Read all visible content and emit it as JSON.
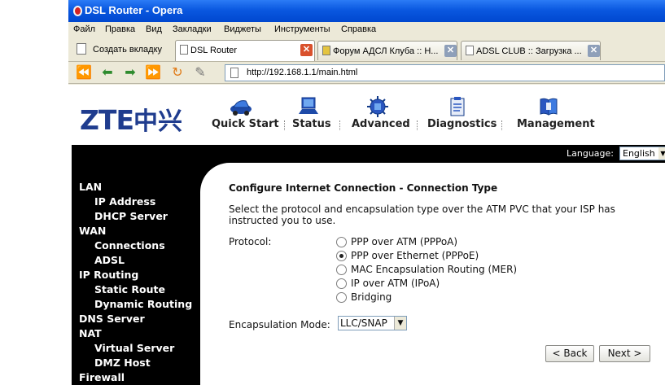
{
  "window": {
    "title": "DSL Router - Opera"
  },
  "menu": [
    "Файл",
    "Правка",
    "Вид",
    "Закладки",
    "Виджеты",
    "Инструменты",
    "Справка"
  ],
  "tabs": {
    "new_tab_label": "Создать вкладку",
    "items": [
      {
        "label": "DSL Router",
        "active": true
      },
      {
        "label": "Форум АДСЛ Клуба :: Н...",
        "active": false
      },
      {
        "label": "ADSL CLUB :: Загрузка ...",
        "active": false
      }
    ]
  },
  "address": {
    "url": "http://192.168.1.1/main.html"
  },
  "logo": {
    "brand": "ZTE",
    "brand_cn": "中兴"
  },
  "topnav": [
    {
      "label": "Quick Start",
      "icon": "car-icon"
    },
    {
      "label": "Status",
      "icon": "laptop-icon"
    },
    {
      "label": "Advanced",
      "icon": "chip-icon"
    },
    {
      "label": "Diagnostics",
      "icon": "clipboard-icon"
    },
    {
      "label": "Management",
      "icon": "book-icon"
    }
  ],
  "language": {
    "label": "Language:",
    "selected": "English"
  },
  "sidebar": {
    "items": [
      {
        "label": "LAN",
        "level": 0
      },
      {
        "label": "IP Address",
        "level": 1
      },
      {
        "label": "DHCP Server",
        "level": 1
      },
      {
        "label": "WAN",
        "level": 0
      },
      {
        "label": "Connections",
        "level": 1
      },
      {
        "label": "ADSL",
        "level": 1
      },
      {
        "label": "IP Routing",
        "level": 0
      },
      {
        "label": "Static Route",
        "level": 1
      },
      {
        "label": "Dynamic Routing",
        "level": 1
      },
      {
        "label": "DNS Server",
        "level": 0
      },
      {
        "label": "NAT",
        "level": 0
      },
      {
        "label": "Virtual Server",
        "level": 1
      },
      {
        "label": "DMZ Host",
        "level": 1
      },
      {
        "label": "Firewall",
        "level": 0
      }
    ]
  },
  "content": {
    "title": "Configure Internet Connection - Connection Type",
    "description": "Select the protocol and encapsulation type over the ATM PVC that your ISP has instructed you to use.",
    "protocol_label": "Protocol:",
    "protocols": [
      {
        "label": "PPP over ATM (PPPoA)",
        "checked": false
      },
      {
        "label": "PPP over Ethernet (PPPoE)",
        "checked": true
      },
      {
        "label": "MAC Encapsulation Routing (MER)",
        "checked": false
      },
      {
        "label": "IP over ATM (IPoA)",
        "checked": false
      },
      {
        "label": "Bridging",
        "checked": false
      }
    ],
    "encap_label": "Encapsulation Mode:",
    "encap_value": "LLC/SNAP",
    "back_label": "< Back",
    "next_label": "Next >"
  },
  "colors": {
    "titlebar": "#0a58e0",
    "logo": "#1f3c8e",
    "page_bg": "#000000",
    "chrome": "#ece9d8"
  }
}
